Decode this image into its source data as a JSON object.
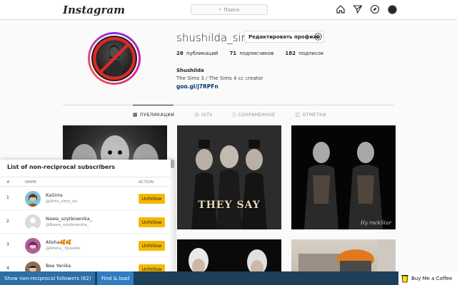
{
  "nav": {
    "logo": "Instagram",
    "search_placeholder": "Поиск",
    "icons": [
      "home-icon",
      "direct-icon",
      "explore-icon",
      "avatar"
    ]
  },
  "profile": {
    "username": "shushilda_sims",
    "edit_label": "Редактировать профиль",
    "stats": {
      "posts_count": "28",
      "posts_label": "публикаций",
      "followers_count": "71",
      "followers_label": "подписчиков",
      "following_count": "182",
      "following_label": "подписок"
    },
    "full_name": "Shushilda",
    "bio": "The Sims 3 / The Sims 4 cc creator",
    "link": "goo.gl/j7RPFn"
  },
  "tabs": [
    {
      "label": "ПУБЛИКАЦИИ",
      "icon": "grid-icon",
      "active": true
    },
    {
      "label": "IGTV",
      "icon": "igtv-icon",
      "active": false
    },
    {
      "label": "СОХРАНЕННОЕ",
      "icon": "bookmark-icon",
      "active": false
    },
    {
      "label": "ОТМЕТКИ",
      "icon": "tag-icon",
      "active": false
    }
  ],
  "grid": {
    "tile2_text": "THEY SAY",
    "tile3_watermark": "Hy rockStar"
  },
  "panel": {
    "title": "List of non-reciprocal subscribers",
    "columns": {
      "num": "#",
      "name": "NAME",
      "action": "ACTION"
    },
    "rows": [
      {
        "num": "1",
        "name": "KaSims",
        "handle": "@Sims_sims_sis",
        "action": "Unfollow"
      },
      {
        "num": "2",
        "name": "Nawa_uzytkownika_",
        "handle": "@Nawa_uzytkownika_",
        "action": "Unfollow"
      },
      {
        "num": "3",
        "name": "Alisha🥰🥰",
        "handle": "@Alisha_ Episode",
        "action": "Unfollow"
      },
      {
        "num": "4",
        "name": "Bee Yanika",
        "handle": "",
        "action": "Unfollow"
      }
    ]
  },
  "bottombar": {
    "show_label": "Show non-reciprocal followers (62)",
    "find_label": "Find & load",
    "coffee_label": "Buy Me a Coffee"
  },
  "colors": {
    "unfollow_button": "#f5b800",
    "bottombar_bg": "#1e3f5a",
    "show_button": "#2b6ea8",
    "find_button": "#2f7dc1",
    "link": "#00376b"
  }
}
